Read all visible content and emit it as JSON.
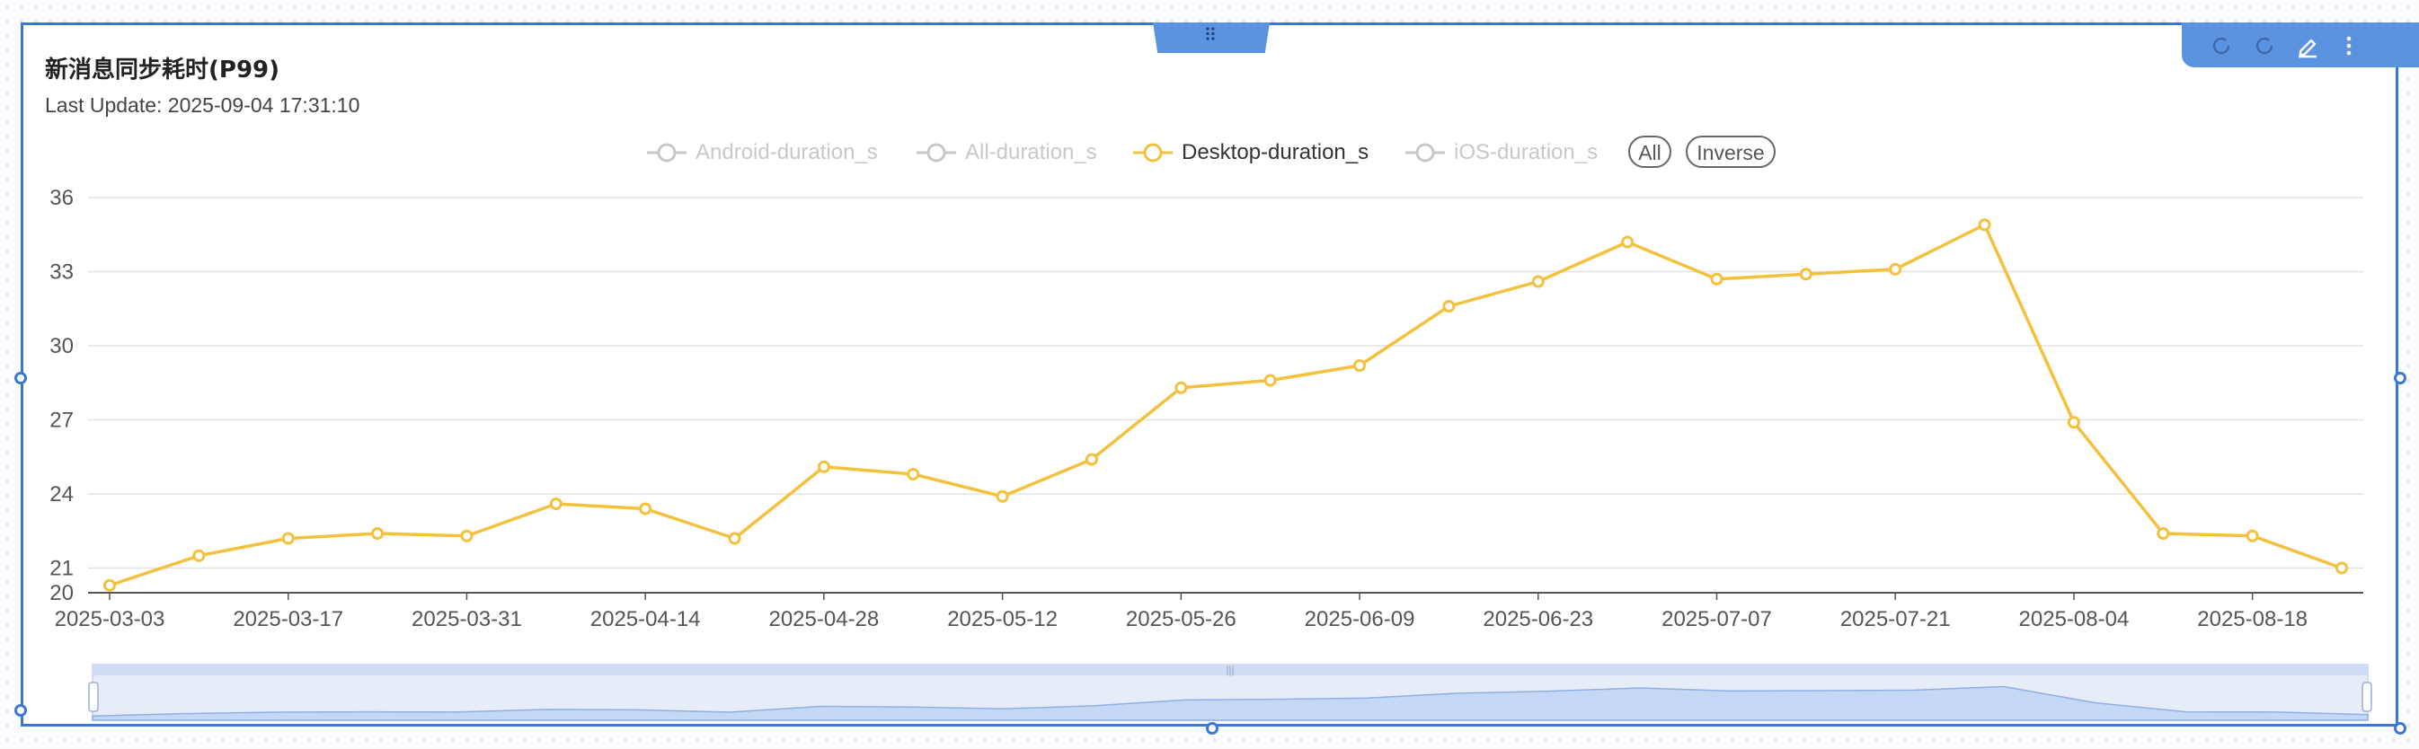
{
  "panel": {
    "title": "新消息同步耗时(P99)",
    "last_update": "Last Update: 2025-09-04 17:31:10",
    "drag_handle": "⠿",
    "toolbar_icons": [
      "refresh-icon",
      "refresh-icon",
      "edit-icon",
      "more-vert-icon"
    ]
  },
  "legend": {
    "items": [
      {
        "label": "Android-duration_s",
        "active": false
      },
      {
        "label": "All-duration_s",
        "active": false
      },
      {
        "label": "Desktop-duration_s",
        "active": true
      },
      {
        "label": "iOS-duration_s",
        "active": false
      }
    ],
    "all_label": "All",
    "inverse_label": "Inverse"
  },
  "colors": {
    "series": "#f4c13d",
    "inactive": "#c8c8c8",
    "accent": "#3b77d8",
    "grid": "#e3e3e3"
  },
  "chart_data": {
    "type": "line",
    "title": "新消息同步耗时(P99)",
    "xlabel": "",
    "ylabel": "",
    "ylim": [
      20,
      36
    ],
    "yticks": [
      20,
      21,
      24,
      27,
      30,
      33,
      36
    ],
    "xtick_labels": [
      "2025-03-03",
      "2025-03-17",
      "2025-03-31",
      "2025-04-14",
      "2025-04-28",
      "2025-05-12",
      "2025-05-26",
      "2025-06-09",
      "2025-06-23",
      "2025-07-07",
      "2025-07-21",
      "2025-08-04",
      "2025-08-18"
    ],
    "x": [
      "2025-03-03",
      "2025-03-10",
      "2025-03-17",
      "2025-03-24",
      "2025-03-31",
      "2025-04-07",
      "2025-04-14",
      "2025-04-21",
      "2025-04-28",
      "2025-05-05",
      "2025-05-12",
      "2025-05-19",
      "2025-05-26",
      "2025-06-02",
      "2025-06-09",
      "2025-06-16",
      "2025-06-23",
      "2025-06-30",
      "2025-07-07",
      "2025-07-14",
      "2025-07-21",
      "2025-07-28",
      "2025-08-04",
      "2025-08-11",
      "2025-08-18",
      "2025-08-25"
    ],
    "series": [
      {
        "name": "Desktop-duration_s",
        "values": [
          20.3,
          21.5,
          22.2,
          22.4,
          22.3,
          23.6,
          23.4,
          22.2,
          25.1,
          24.8,
          23.9,
          25.4,
          28.3,
          28.6,
          29.2,
          31.6,
          32.6,
          34.2,
          32.7,
          32.9,
          33.1,
          34.9,
          26.9,
          22.4,
          22.3,
          21.0
        ]
      }
    ],
    "legend_position": "top-center",
    "grid": true,
    "data_zoom": true
  }
}
